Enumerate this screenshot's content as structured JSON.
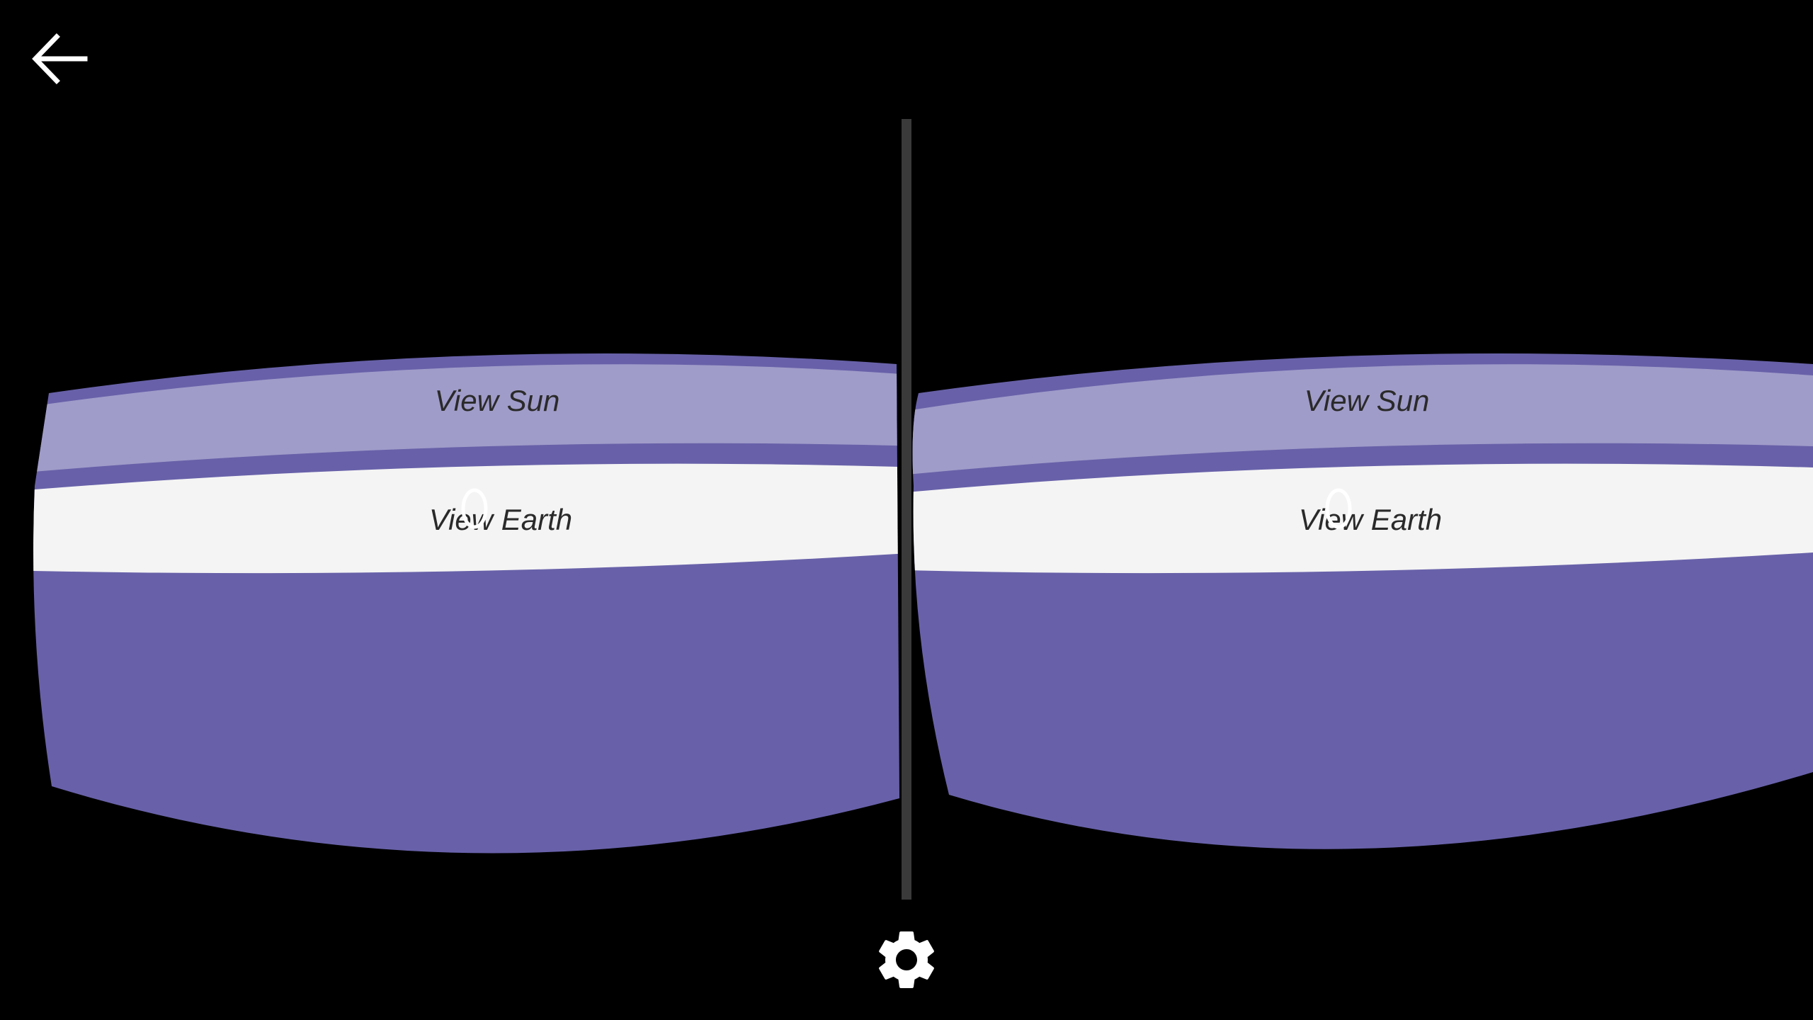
{
  "left_eye": {
    "view_sun_label": "View Sun",
    "view_earth_label": "View Earth"
  },
  "right_eye": {
    "view_sun_label": "View Sun",
    "view_earth_label": "View Earth"
  },
  "toolbar": {
    "back_icon": "arrow-left-icon",
    "settings_icon": "gear-icon"
  },
  "colors": {
    "panel": "#6861a9",
    "highlight": "#a09cc9",
    "selected": "#f4f4f4",
    "background": "#000000"
  }
}
